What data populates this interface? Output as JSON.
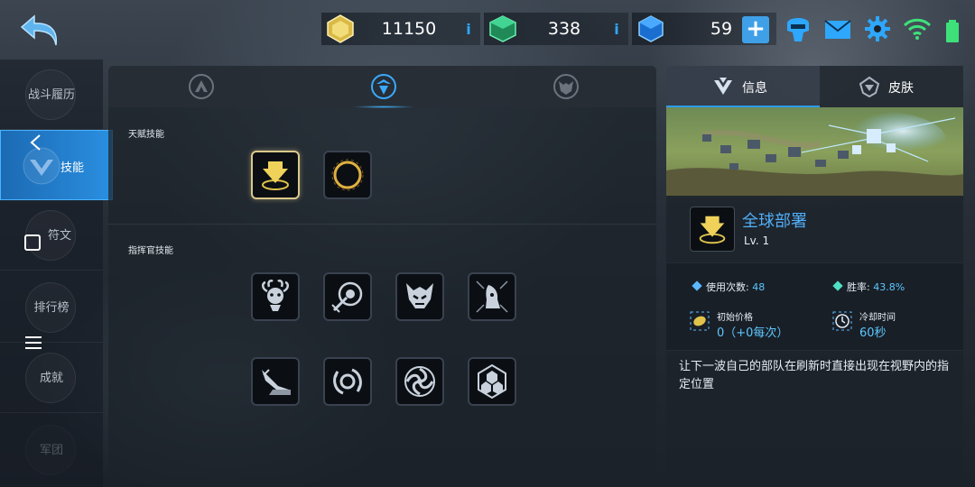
{
  "topbar": {
    "gold": "11150",
    "green_gems": "338",
    "blue_gems": "59",
    "info_label": "i",
    "plus_label": "+",
    "icons": [
      "back-arrow-icon",
      "helmet-icon",
      "mail-icon",
      "gear-icon",
      "wifi-icon",
      "battery-icon"
    ]
  },
  "nav": {
    "items": [
      {
        "label": "战斗履历"
      },
      {
        "label": "技能"
      },
      {
        "label": "符文"
      },
      {
        "label": "排行榜"
      },
      {
        "label": "成就"
      },
      {
        "label": "军团"
      }
    ],
    "active_index": 1
  },
  "center": {
    "tabs": [
      "commander-tab-icon",
      "skill-tab-icon",
      "skull-tab-icon"
    ],
    "active_tab": 1,
    "talent_title": "天赋技能",
    "commander_title": "指挥官技能",
    "talent_skills": [
      "deploy-skill-icon",
      "ring-skill-icon"
    ],
    "commander_skills_row1": [
      "medusa-skill-icon",
      "target-skill-icon",
      "demon-skill-icon",
      "horn-skill-icon"
    ],
    "commander_skills_row2": [
      "missile-skill-icon",
      "vortex-skill-icon",
      "spiral-skill-icon",
      "hexagon-skill-icon"
    ]
  },
  "right": {
    "tab_info": "信息",
    "tab_skin": "皮肤",
    "skill_name": "全球部署",
    "skill_level": "Lv. 1",
    "uses_label": "使用次数:",
    "uses_value": "48",
    "winrate_label": "胜率:",
    "winrate_value": "43.8%",
    "price_label": "初始价格",
    "price_value": "0（+0每次）",
    "cooldown_label": "冷却时间",
    "cooldown_value": "60秒",
    "description": "让下一波自己的部队在刷新时直接出现在视野内的指定位置"
  },
  "colors": {
    "accent": "#2e9bf0",
    "value_blue": "#5cc7ff",
    "name_blue": "#51aef7",
    "gold": "#e0c34a"
  }
}
